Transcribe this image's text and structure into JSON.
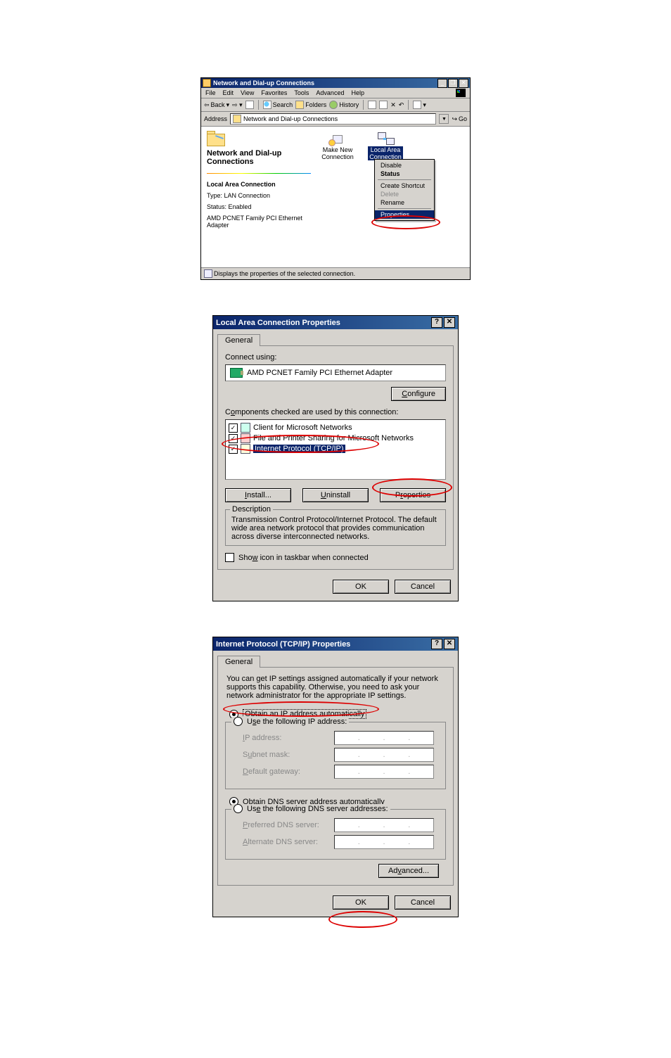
{
  "win1": {
    "title": "Network and Dial-up Connections",
    "menu": [
      "File",
      "Edit",
      "View",
      "Favorites",
      "Tools",
      "Advanced",
      "Help"
    ],
    "toolbar": {
      "back": "Back",
      "search": "Search",
      "folders": "Folders",
      "history": "History"
    },
    "address_label": "Address",
    "address_value": "Network and Dial-up Connections",
    "go": "Go",
    "left": {
      "heading": "Network and Dial-up Connections",
      "sel_name": "Local Area Connection",
      "type_line": "Type: LAN Connection",
      "status_line": "Status: Enabled",
      "adapter": "AMD PCNET Family PCI Ethernet Adapter"
    },
    "icons": {
      "make_new": "Make New\nConnection",
      "lan": "Local Area\nConnection"
    },
    "ctx": {
      "disable": "Disable",
      "status": "Status",
      "shortcut": "Create Shortcut",
      "delete": "Delete",
      "rename": "Rename",
      "properties": "Properties"
    },
    "statusbar": "Displays the properties of the selected connection."
  },
  "win2": {
    "title": "Local Area Connection Properties",
    "tab": "General",
    "connect_using": "Connect using:",
    "adapter": "AMD PCNET Family PCI Ethernet Adapter",
    "configure": "Configure",
    "components_label": "Components checked are used by this connection:",
    "items": {
      "client": "Client for Microsoft Networks",
      "fps": "File and Printer Sharing for Microsoft Networks",
      "tcp": "Internet Protocol (TCP/IP)"
    },
    "install": "Install...",
    "uninstall": "Uninstall",
    "properties": "Properties",
    "desc_legend": "Description",
    "desc_text": "Transmission Control Protocol/Internet Protocol. The default wide area network protocol that provides communication across diverse interconnected networks.",
    "show_icon": "Show icon in taskbar when connected",
    "ok": "OK",
    "cancel": "Cancel"
  },
  "win3": {
    "title": "Internet Protocol (TCP/IP) Properties",
    "tab": "General",
    "intro": "You can get IP settings assigned automatically if your network supports this capability. Otherwise, you need to ask your network administrator for the appropriate IP settings.",
    "obtain_ip": "Obtain an IP address automatically",
    "use_ip": "Use the following IP address:",
    "ip_label": "IP address:",
    "subnet_label": "Subnet mask:",
    "gw_label": "Default gateway:",
    "obtain_dns": "Obtain DNS server address automatically",
    "use_dns": "Use the following DNS server addresses:",
    "pref_dns": "Preferred DNS server:",
    "alt_dns": "Alternate DNS server:",
    "advanced": "Advanced...",
    "ok": "OK",
    "cancel": "Cancel"
  }
}
